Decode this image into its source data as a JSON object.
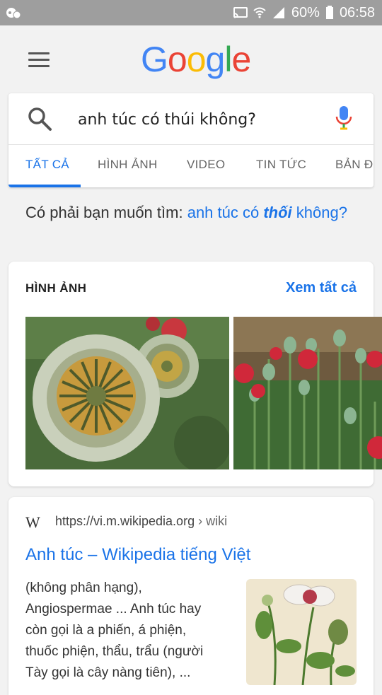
{
  "status_bar": {
    "battery": "60%",
    "time": "06:58"
  },
  "header": {
    "logo_letters": [
      {
        "ch": "G",
        "color": "#4285F4"
      },
      {
        "ch": "o",
        "color": "#EA4335"
      },
      {
        "ch": "o",
        "color": "#FBBC05"
      },
      {
        "ch": "g",
        "color": "#4285F4"
      },
      {
        "ch": "l",
        "color": "#34A853"
      },
      {
        "ch": "e",
        "color": "#EA4335"
      }
    ]
  },
  "search": {
    "query": "anh túc có thúi không?"
  },
  "tabs": [
    "TẤT CẢ",
    "HÌNH ẢNH",
    "VIDEO",
    "TIN TỨC",
    "BẢN Đ"
  ],
  "did_you_mean": {
    "prefix": "Có phải bạn muốn tìm:",
    "suggestion_plain": "anh túc có",
    "suggestion_bold": "thối",
    "suggestion_end": "không?"
  },
  "images": {
    "title": "HÌNH ẢNH",
    "see_all": "Xem tất cả"
  },
  "result": {
    "site_logo": "W",
    "url_base": "https://vi.m.wikipedia.org",
    "url_path": "› wiki",
    "title": "Anh túc – Wikipedia tiếng Việt",
    "snippet": [
      "(không phân hạng),",
      "Angiospermae ... Anh túc hay",
      "còn gọi là a phiến, á phiện,",
      "thuốc phiện, thẩu, trẩu (người",
      "Tày gọi là cây nàng tiên), ..."
    ]
  },
  "colors": {
    "accent": "#1a73e8",
    "status_bar": "#9e9e9e",
    "background": "#f2f2f2"
  }
}
